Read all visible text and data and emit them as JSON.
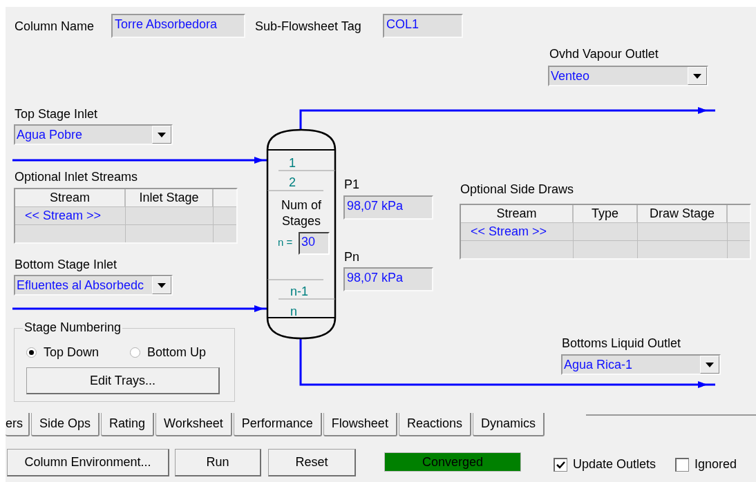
{
  "column_name": {
    "label": "Column Name",
    "value": "Torre Absorbedora"
  },
  "subflowsheet_tag": {
    "label": "Sub-Flowsheet Tag",
    "value": "COL1"
  },
  "ovhd_vapour_outlet": {
    "label": "Ovhd Vapour Outlet",
    "value": "Venteo"
  },
  "top_stage_inlet": {
    "label": "Top Stage Inlet",
    "value": "Agua Pobre"
  },
  "optional_inlet_streams": {
    "title": "Optional Inlet Streams",
    "columns": [
      "Stream",
      "Inlet Stage"
    ],
    "rows": [
      {
        "stream": "<< Stream >>"
      }
    ]
  },
  "bottom_stage_inlet": {
    "label": "Bottom Stage Inlet",
    "value": "Efluentes al Absorbedc"
  },
  "stage_numbering": {
    "title": "Stage Numbering",
    "options": [
      {
        "label": "Top Down",
        "selected": true
      },
      {
        "label": "Bottom Up",
        "selected": false
      }
    ],
    "button": "Edit Trays..."
  },
  "column": {
    "top_stages": [
      "1",
      "2"
    ],
    "num_stages_label": "Num of Stages",
    "n_label": "n =",
    "num_stages": "30",
    "bottom_stages": [
      "n-1",
      "n"
    ]
  },
  "pressures": [
    {
      "label": "P1",
      "value": "98,07 kPa"
    },
    {
      "label": "Pn",
      "value": "98,07 kPa"
    }
  ],
  "optional_side_draws": {
    "title": "Optional Side Draws",
    "columns": [
      "Stream",
      "Type",
      "Draw Stage"
    ],
    "rows": [
      {
        "stream": "<< Stream >>"
      }
    ]
  },
  "bottoms_liquid_outlet": {
    "label": "Bottoms Liquid Outlet",
    "value": "Agua Rica-1"
  },
  "tabs": [
    {
      "label": "ers",
      "selected": false
    },
    {
      "label": "Side Ops",
      "selected": false
    },
    {
      "label": "Rating",
      "selected": false
    },
    {
      "label": "Worksheet",
      "selected": false
    },
    {
      "label": "Performance",
      "selected": false
    },
    {
      "label": "Flowsheet",
      "selected": false
    },
    {
      "label": "Reactions",
      "selected": false
    },
    {
      "label": "Dynamics",
      "selected": false
    }
  ],
  "buttons": [
    "Column Environment...",
    "Run",
    "Reset"
  ],
  "status": {
    "text": "Converged",
    "kind": "converged"
  },
  "checkboxes": [
    {
      "label": "Update Outlets",
      "checked": true
    },
    {
      "label": "Ignored",
      "checked": false
    }
  ]
}
